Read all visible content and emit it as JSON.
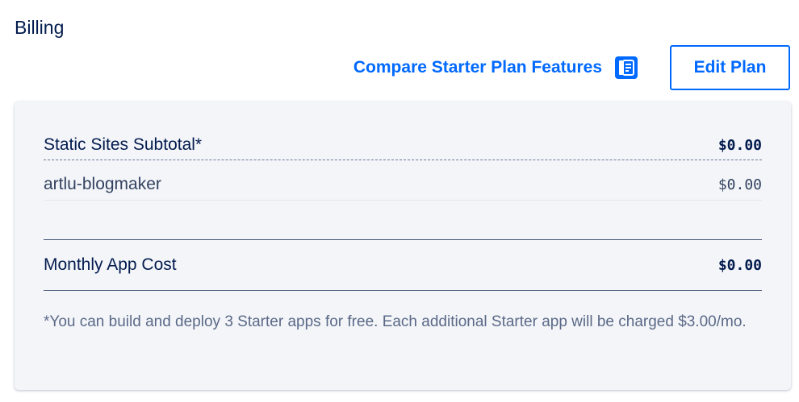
{
  "billing": {
    "title": "Billing",
    "compare_link": "Compare Starter Plan Features",
    "compare_icon": "document-list-icon",
    "edit_button": "Edit Plan"
  },
  "summary": {
    "subtotal": {
      "label": "Static Sites Subtotal*",
      "amount": "$0.00"
    },
    "items": [
      {
        "name": "artlu-blogmaker",
        "amount": "$0.00"
      }
    ],
    "total": {
      "label": "Monthly App Cost",
      "amount": "$0.00"
    },
    "footnote": "*You can build and deploy 3 Starter apps for free. Each additional Starter app will be charged $3.00/mo."
  },
  "colors": {
    "accent": "#0069ff",
    "text_primary": "#031b4e",
    "panel_bg": "#f3f5f9"
  }
}
